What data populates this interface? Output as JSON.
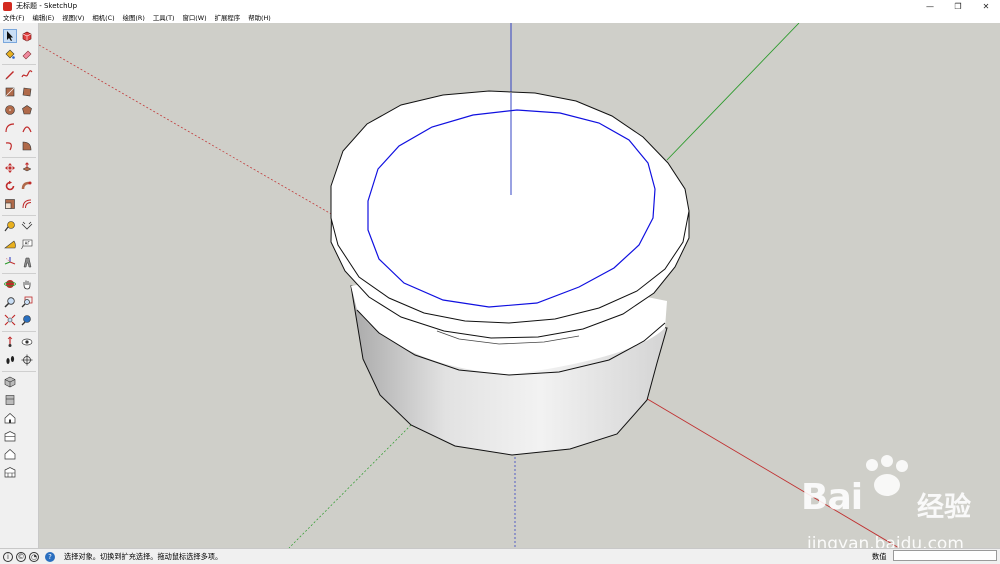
{
  "window": {
    "title": "无标题 - SketchUp",
    "controls": {
      "minimize": "—",
      "restore": "❐",
      "close": "✕"
    }
  },
  "menu": [
    "文件(F)",
    "编辑(E)",
    "视图(V)",
    "相机(C)",
    "绘图(R)",
    "工具(T)",
    "窗口(W)",
    "扩展程序",
    "帮助(H)"
  ],
  "toolbar": {
    "active_tool": "select",
    "tools": [
      {
        "name": "select",
        "icon": "arrow-cursor-icon"
      },
      {
        "name": "make-component",
        "icon": "component-icon"
      },
      {
        "name": "paint-bucket",
        "icon": "paint-bucket-icon"
      },
      {
        "name": "eraser",
        "icon": "eraser-icon"
      },
      {
        "name": "line",
        "icon": "pencil-icon"
      },
      {
        "name": "freehand",
        "icon": "freehand-icon"
      },
      {
        "name": "rectangle",
        "icon": "rectangle-icon"
      },
      {
        "name": "rotated-rectangle",
        "icon": "rotated-rectangle-icon"
      },
      {
        "name": "circle",
        "icon": "circle-icon"
      },
      {
        "name": "polygon",
        "icon": "polygon-icon"
      },
      {
        "name": "arc",
        "icon": "arc-icon"
      },
      {
        "name": "two-point-arc",
        "icon": "two-point-arc-icon"
      },
      {
        "name": "three-point-arc",
        "icon": "three-point-arc-icon"
      },
      {
        "name": "pie",
        "icon": "pie-icon"
      },
      {
        "name": "move",
        "icon": "move-icon"
      },
      {
        "name": "push-pull",
        "icon": "push-pull-icon"
      },
      {
        "name": "rotate",
        "icon": "rotate-icon"
      },
      {
        "name": "follow-me",
        "icon": "follow-me-icon"
      },
      {
        "name": "scale",
        "icon": "scale-icon"
      },
      {
        "name": "offset",
        "icon": "offset-icon"
      },
      {
        "name": "tape-measure",
        "icon": "tape-measure-icon"
      },
      {
        "name": "dimension",
        "icon": "dimension-icon"
      },
      {
        "name": "protractor",
        "icon": "protractor-icon"
      },
      {
        "name": "text",
        "icon": "text-icon"
      },
      {
        "name": "axes",
        "icon": "axes-icon"
      },
      {
        "name": "3d-text",
        "icon": "3d-text-icon"
      },
      {
        "name": "orbit",
        "icon": "orbit-icon"
      },
      {
        "name": "pan",
        "icon": "pan-hand-icon"
      },
      {
        "name": "zoom",
        "icon": "zoom-icon"
      },
      {
        "name": "zoom-window",
        "icon": "zoom-window-icon"
      },
      {
        "name": "zoom-extents",
        "icon": "zoom-extents-icon"
      },
      {
        "name": "previous-view",
        "icon": "previous-view-icon"
      },
      {
        "name": "position-camera",
        "icon": "position-camera-icon"
      },
      {
        "name": "look-around",
        "icon": "eye-icon"
      },
      {
        "name": "walk",
        "icon": "footprints-icon"
      },
      {
        "name": "section-plane",
        "icon": "section-plane-icon"
      },
      {
        "name": "iso-view",
        "icon": "iso-cube-icon"
      },
      {
        "name": "top-view",
        "icon": "top-view-icon"
      },
      {
        "name": "front-view",
        "icon": "front-house-icon"
      },
      {
        "name": "right-view",
        "icon": "right-house-icon"
      },
      {
        "name": "back-view",
        "icon": "back-house-icon"
      },
      {
        "name": "left-view",
        "icon": "left-house-icon"
      }
    ]
  },
  "watermark": {
    "logo": "Bai",
    "logo2": "经验",
    "url": "jingyan.baidu.com"
  },
  "status": {
    "text": "选择对象。切换到扩充选择。拖动鼠标选择多项。",
    "measurements_label": "数值",
    "measurements_value": "",
    "icons": [
      "geo-location-icon",
      "credits-icon",
      "user-icon",
      "help-icon"
    ]
  },
  "colors": {
    "viewport_bg": "#cfcfc9",
    "axis_red": "#c03030",
    "axis_green": "#2a9a2a",
    "axis_blue": "#2030c0",
    "selected_edge": "#1010e0"
  }
}
